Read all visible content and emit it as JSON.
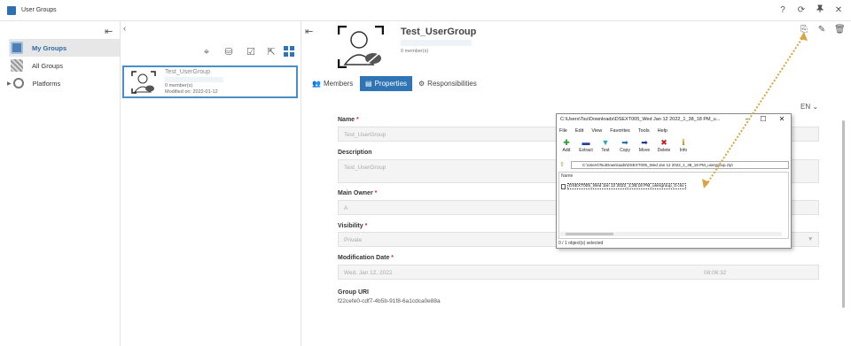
{
  "window": {
    "title": "User Groups",
    "controls": [
      "?",
      "⟳",
      "✎",
      "✕"
    ]
  },
  "sidebar": {
    "items": [
      {
        "label": "My Groups",
        "icon": "group-icon",
        "active": true
      },
      {
        "label": "All Groups",
        "icon": "grid-icon",
        "active": false
      },
      {
        "label": "Platforms",
        "icon": "platform-icon",
        "active": false
      }
    ]
  },
  "group_list": {
    "card": {
      "name": "Test_UserGroup",
      "members": "0 member(s)",
      "modified": "Modified on: 2022-01-12"
    }
  },
  "group": {
    "name": "Test_UserGroup",
    "members": "0 member(s)"
  },
  "tabs": [
    {
      "label": "Members",
      "active": false
    },
    {
      "label": "Properties",
      "active": true
    },
    {
      "label": "Responsibilities",
      "active": false
    }
  ],
  "language": "EN",
  "form": {
    "name_label": "Name",
    "name_value": "Test_UserGroup",
    "description_label": "Description",
    "description_value": "Test_UserGroup",
    "owner_label": "Main Owner",
    "owner_value": "A",
    "visibility_label": "Visibility",
    "visibility_value": "Private",
    "modification_label": "Modification Date",
    "modification_date": "Wed, Jan 12, 2022",
    "modification_time": "08:06:32",
    "uri_label": "Group URI",
    "uri_value": "f22cefe0-cdf7-4b5b-91f8-6a1cdca0e88a"
  },
  "archiver": {
    "title": "C:\\Users\\Tsu\\Downloads\\DSEXT005_Wed Jan 12 2022_1_38_18 PM_u...",
    "menu": [
      "File",
      "Edit",
      "View",
      "Favorites",
      "Tools",
      "Help"
    ],
    "tools": [
      {
        "label": "Add",
        "glyph": "✚",
        "color": "#2e9b2e"
      },
      {
        "label": "Extract",
        "glyph": "▬",
        "color": "#1f3fa8"
      },
      {
        "label": "Test",
        "glyph": "▼",
        "color": "#2aa7b5"
      },
      {
        "label": "Copy",
        "glyph": "➡",
        "color": "#1c6fa8"
      },
      {
        "label": "Move",
        "glyph": "➡",
        "color": "#1a2f8a"
      },
      {
        "label": "Delete",
        "glyph": "✖",
        "color": "#c41c1c"
      },
      {
        "label": "Info",
        "glyph": "ℹ",
        "color": "#b8860b"
      }
    ],
    "path": "C:\\Users\\Tsu\\Downloads\\DSEXT005_Wed Jan 12 2022_1_38_18 PM_usergroup.zip\\",
    "column_name": "Name",
    "file": "DSEXT005_Wed Jan 12 2022_1;38;18 PM_usergroup_0.csv",
    "status": "0 / 1 object(s) selected"
  },
  "colors": {
    "accent": "#2f74b5",
    "annotation_arrow": "#d9a441"
  }
}
